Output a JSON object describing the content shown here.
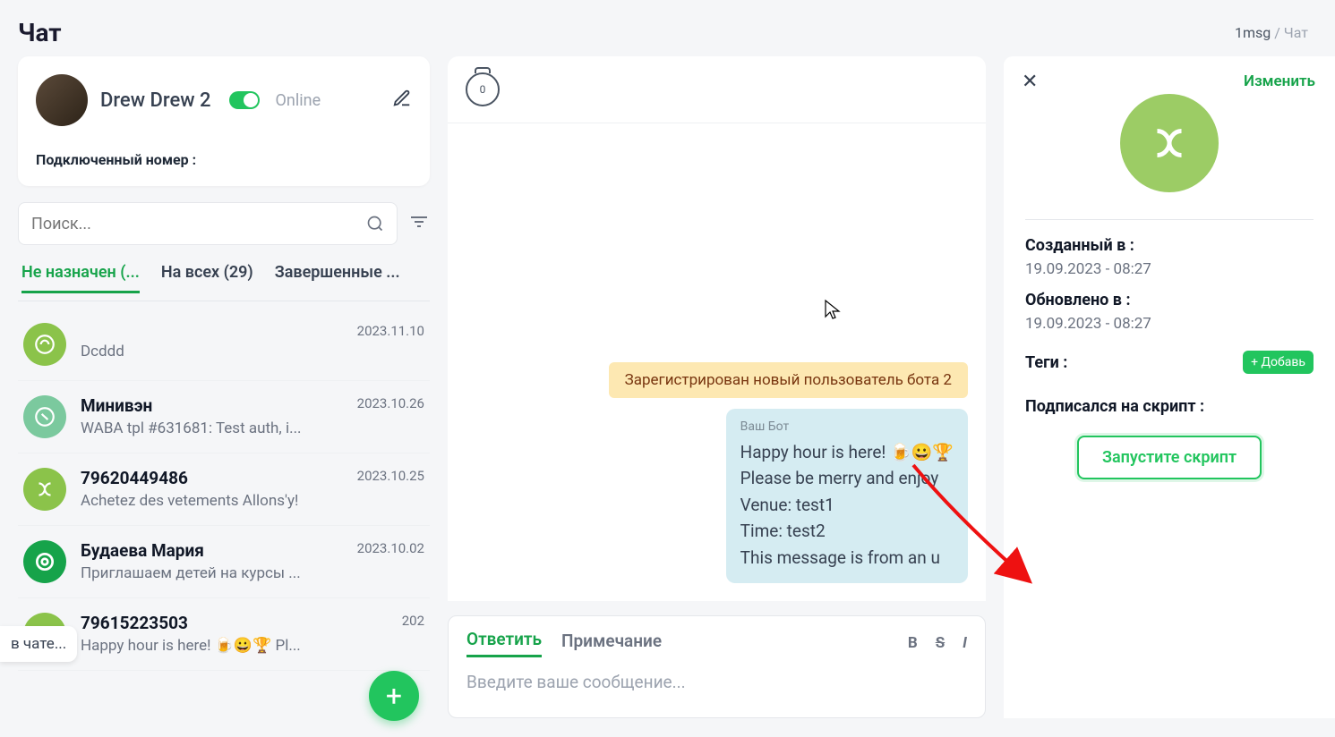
{
  "header": {
    "title": "Чат"
  },
  "breadcrumb": {
    "root": "1msg",
    "current": "Чат"
  },
  "profile": {
    "name": "Drew Drew 2",
    "status": "Online",
    "connected_label": "Подключенный номер :"
  },
  "search": {
    "placeholder": "Поиск..."
  },
  "tabs": {
    "unassigned": "Не назначен (...",
    "all": "На всех (29)",
    "completed": "Завершенные ..."
  },
  "chats": [
    {
      "name": "",
      "preview": "Dcddd",
      "date": "2023.11.10"
    },
    {
      "name": "Минивэн",
      "preview": "WABA tpl #631681: Test auth, i...",
      "date": "2023.10.26"
    },
    {
      "name": "79620449486",
      "preview": "Achetez des vetements Allons'y!",
      "date": "2023.10.25"
    },
    {
      "name": "Будаева Мария",
      "preview": "Приглашаем детей на курсы ...",
      "date": "2023.10.02"
    },
    {
      "name": "79615223503",
      "preview": "Happy hour is here! 🍺😀🏆 Pl...",
      "date": "202"
    }
  ],
  "chip": "в чате...",
  "timer": "0",
  "system_message": "Зарегистрирован новый пользователь бота 2",
  "bot_message": {
    "label": "Ваш Бот",
    "line1": "Happy hour is here! 🍺😀🏆",
    "line2": "Please be merry and enjoy",
    "line3": "Venue: test1",
    "line4": "Time: test2",
    "line5": "This message is from an u"
  },
  "composer": {
    "reply": "Ответить",
    "note": "Примечание",
    "placeholder": "Введите ваше сообщение..."
  },
  "details": {
    "edit": "Изменить",
    "created_label": "Созданный в :",
    "created_value": "19.09.2023 - 08:27",
    "updated_label": "Обновлено в :",
    "updated_value": "19.09.2023 - 08:27",
    "tags_label": "Теги :",
    "add_tag": "+ Добавь",
    "script_label": "Подписался на скрипт :",
    "run_script": "Запустите скрипт"
  }
}
